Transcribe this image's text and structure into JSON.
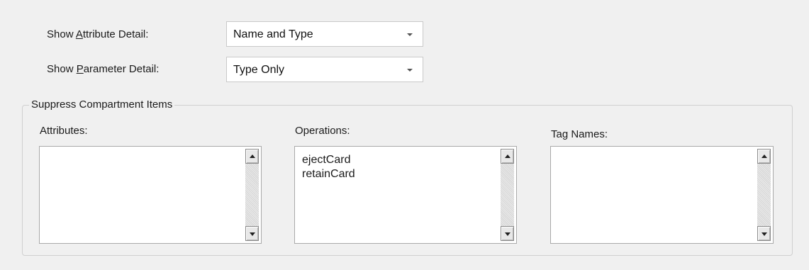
{
  "show_attribute_detail": {
    "label_pre": "Show ",
    "label_mnemonic": "A",
    "label_post": "ttribute Detail:",
    "value": "Name and Type"
  },
  "show_parameter_detail": {
    "label_pre": "Show ",
    "label_mnemonic": "P",
    "label_post": "arameter Detail:",
    "value": "Type Only"
  },
  "suppress_group": {
    "title": "Suppress Compartment Items",
    "attributes": {
      "label": "Attributes:",
      "items": []
    },
    "operations": {
      "label": "Operations:",
      "items": [
        "ejectCard",
        "retainCard"
      ]
    },
    "tag_names": {
      "label": "Tag Names:",
      "items": []
    }
  }
}
